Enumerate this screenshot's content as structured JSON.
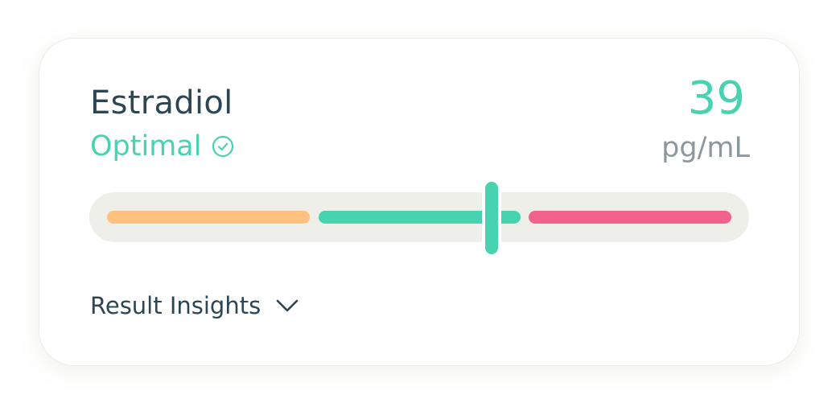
{
  "biomarker": {
    "name": "Estradiol",
    "status": "Optimal",
    "status_icon": "check-circle-icon",
    "value": "39",
    "unit": "pg/mL"
  },
  "range_bar": {
    "segments": [
      {
        "name": "low",
        "color": "#ffc17e"
      },
      {
        "name": "optimal",
        "color": "#47d3b0"
      },
      {
        "name": "high",
        "color": "#f2628a"
      }
    ],
    "marker_position_fraction": 0.61,
    "marker_color": "#47d3b0"
  },
  "insights": {
    "label": "Result Insights",
    "icon": "chevron-down-icon"
  },
  "colors": {
    "accent": "#47d3b0",
    "text": "#2c4654",
    "muted": "#8d989e"
  }
}
